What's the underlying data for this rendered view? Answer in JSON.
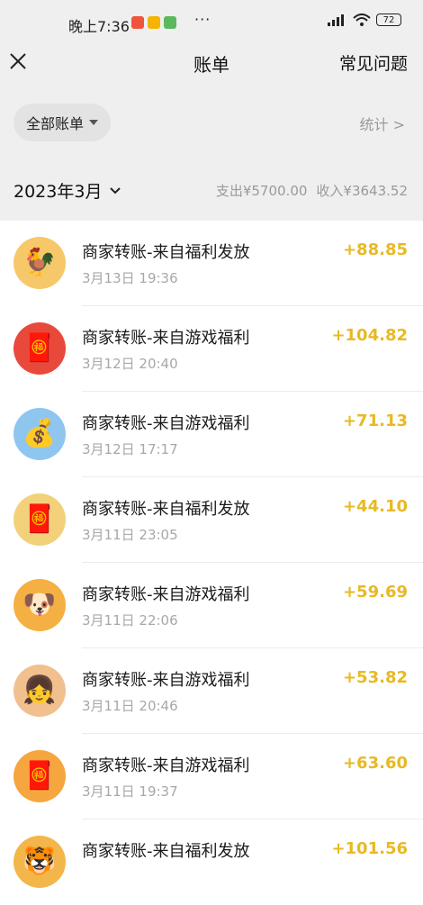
{
  "status_bar": {
    "time": "晚上7:36",
    "more": "···",
    "battery": "72",
    "app_icons": [
      {
        "name": "app-icon-red",
        "color": "#f0553c"
      },
      {
        "name": "app-icon-yellow",
        "color": "#f4b400"
      },
      {
        "name": "app-icon-green",
        "color": "#5cb85c"
      }
    ]
  },
  "header": {
    "title": "账单",
    "faq_label": "常见问题"
  },
  "filter": {
    "selected": "全部账单",
    "stats_label": "统计 >"
  },
  "month_bar": {
    "month": "2023年3月",
    "expense": "支出¥5700.00",
    "income": "收入¥3643.52"
  },
  "accent_color": "#e8b923",
  "transactions": [
    {
      "title": "商家转账-来自福利发放",
      "date": "3月13日 19:36",
      "amount": "+88.85",
      "avatar_icon": "rooster-icon",
      "avatar_glyph": "🐓",
      "avatar_bg": "#f7c86a"
    },
    {
      "title": "商家转账-来自游戏福利",
      "date": "3月12日 20:40",
      "amount": "+104.82",
      "avatar_icon": "fortune-god-icon",
      "avatar_glyph": "🧧",
      "avatar_bg": "#e9493a"
    },
    {
      "title": "商家转账-来自游戏福利",
      "date": "3月12日 17:17",
      "amount": "+71.13",
      "avatar_icon": "fortune-god-icon",
      "avatar_glyph": "💰",
      "avatar_bg": "#8fc6ef"
    },
    {
      "title": "商家转账-来自福利发放",
      "date": "3月11日 23:05",
      "amount": "+44.10",
      "avatar_icon": "fortune-god-icon",
      "avatar_glyph": "🧧",
      "avatar_bg": "#f3d17a"
    },
    {
      "title": "商家转账-来自游戏福利",
      "date": "3月11日 22:06",
      "amount": "+59.69",
      "avatar_icon": "dog-icon",
      "avatar_glyph": "🐶",
      "avatar_bg": "#f4b042"
    },
    {
      "title": "商家转账-来自游戏福利",
      "date": "3月11日 20:46",
      "amount": "+53.82",
      "avatar_icon": "girl-icon",
      "avatar_glyph": "👧",
      "avatar_bg": "#f2c08f"
    },
    {
      "title": "商家转账-来自游戏福利",
      "date": "3月11日 19:37",
      "amount": "+63.60",
      "avatar_icon": "fortune-god-icon",
      "avatar_glyph": "🧧",
      "avatar_bg": "#f6a63e"
    },
    {
      "title": "商家转账-来自福利发放",
      "date": "",
      "amount": "+101.56",
      "avatar_icon": "tiger-icon",
      "avatar_glyph": "🐯",
      "avatar_bg": "#f3b64a"
    }
  ]
}
